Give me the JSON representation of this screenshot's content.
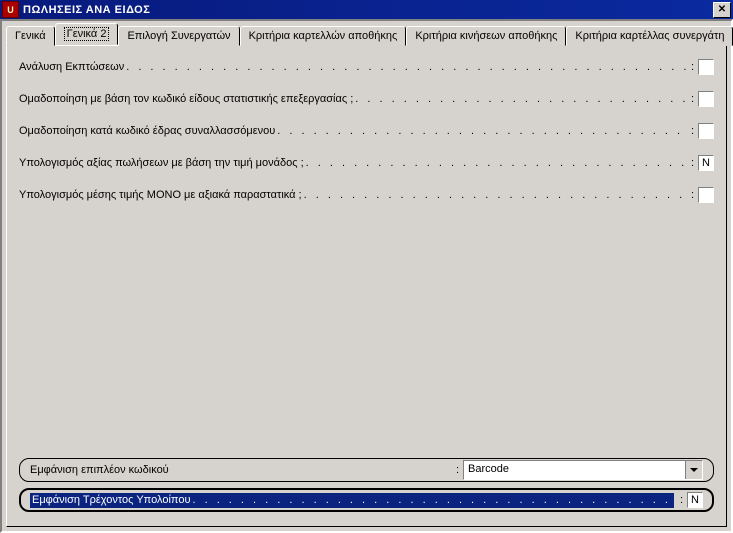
{
  "window": {
    "title": "ΠΩΛΗΣΕΙΣ ΑΝΑ ΕΙΔΟΣ",
    "close_glyph": "✕",
    "icon_letter": "U"
  },
  "tabs": [
    {
      "label": "Γενικά"
    },
    {
      "label": "Γενικά 2"
    },
    {
      "label": "Επιλογή Συνεργατών"
    },
    {
      "label": "Κριτήρια καρτελλών αποθήκης"
    },
    {
      "label": "Κριτήρια κινήσεων αποθήκης"
    },
    {
      "label": "Κριτήρια καρτέλλας συνεργάτη"
    }
  ],
  "active_tab_index": 1,
  "rows": [
    {
      "label": "Ανάλυση Εκπτώσεων",
      "value": ""
    },
    {
      "label": "Ομαδοποίηση με βάση τον κωδικό είδους στατιστικής επεξεργασίας ;",
      "value": ""
    },
    {
      "label": "Ομαδοποίηση κατά κωδικό έδρας συναλλασσόμενου",
      "value": ""
    },
    {
      "label": "Υπολογισμός αξίας πωλήσεων με βάση την τιμή μονάδος ;",
      "value": "Ν"
    },
    {
      "label": "Υπολογισμός μέσης τιμής ΜΟΝΟ με αξιακά παραστατικά ;",
      "value": ""
    }
  ],
  "extra_code": {
    "label": "Εμφάνιση επιπλέον κωδικού",
    "selected": "Barcode"
  },
  "running_balance": {
    "label": "Εμφάνιση Τρέχοντος Υπολοίπου",
    "value": "Ν"
  },
  "leader_dots": ". . . . . . . . . . . . . . . . . . . . . . . . . . . . . . . . . . . . . . . . . . . . . . . . . . . . . . . . . . . . . . . . . . . . . . . . . . . . . . . . . . . . . . . . . . . . . . . . . . . . . . . . . . . . . . . . . . . . . . . . . . . . . . . . . . . . . . . . . . . . . . . . . . . . . . . . . . . . . . . ."
}
